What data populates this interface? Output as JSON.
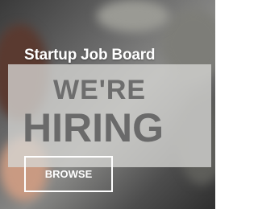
{
  "card": {
    "title": "Startup Job Board",
    "sign_line1": "WE'RE",
    "sign_line2": "HIRING",
    "button_label": "BROWSE"
  }
}
